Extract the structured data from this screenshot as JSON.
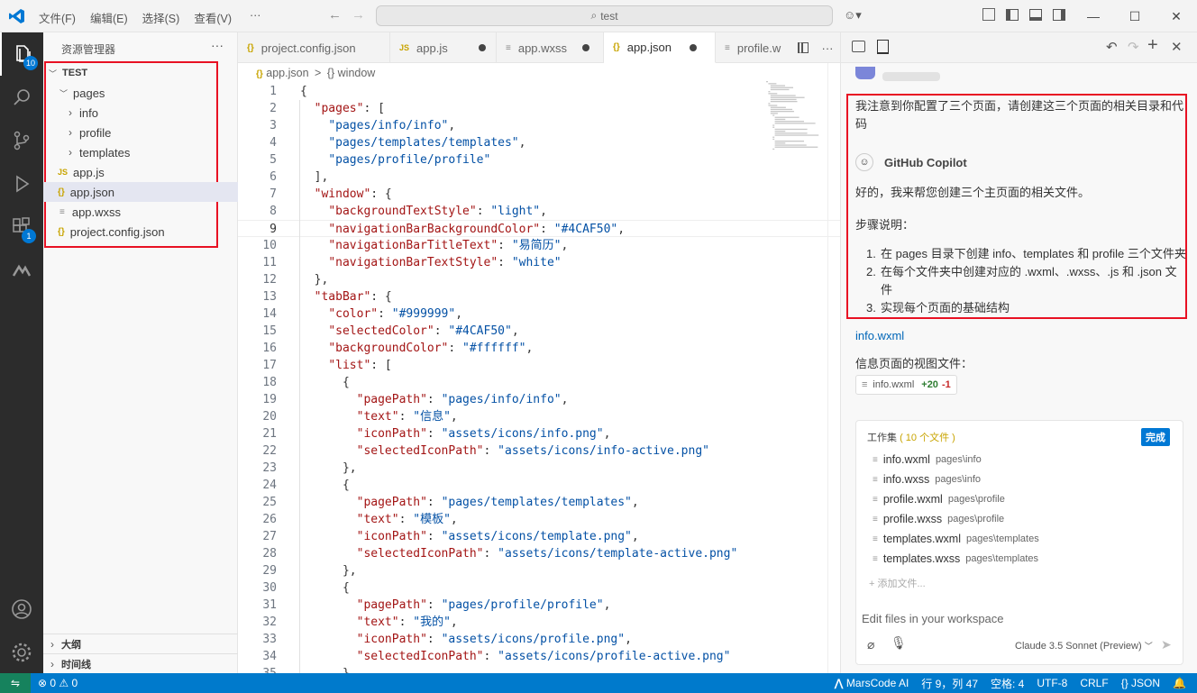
{
  "titlebar": {
    "menus": [
      "文件(F)",
      "编辑(E)",
      "选择(S)",
      "查看(V)",
      "···"
    ],
    "search": "test"
  },
  "activity": {
    "explorer_badge": "10",
    "extensions_badge": "1"
  },
  "sidebar": {
    "title": "资源管理器",
    "more": "···",
    "root": "TEST",
    "items": [
      {
        "label": "pages",
        "icon": "chevron-down-icon"
      },
      {
        "label": "info",
        "icon": "chevron-right-icon"
      },
      {
        "label": "profile",
        "icon": "chevron-right-icon"
      },
      {
        "label": "templates",
        "icon": "chevron-right-icon"
      },
      {
        "label": "app.js",
        "icon": "js-file-icon"
      },
      {
        "label": "app.json",
        "icon": "json-file-icon"
      },
      {
        "label": "app.wxss",
        "icon": "wxss-file-icon"
      },
      {
        "label": "project.config.json",
        "icon": "json-file-icon"
      }
    ],
    "outline": "大纲",
    "timeline": "时间线"
  },
  "tabs": [
    "project.config.json",
    "app.js",
    "app.wxss",
    "app.json",
    "profile.w"
  ],
  "breadcrumb": {
    "file": "app.json",
    "sep": ">",
    "node": "{} window"
  },
  "code": [
    "{",
    "  \"pages\": [",
    "    \"pages/info/info\",",
    "    \"pages/templates/templates\",",
    "    \"pages/profile/profile\"",
    "  ],",
    "  \"window\": {",
    "    \"backgroundTextStyle\": \"light\",",
    "    \"navigationBarBackgroundColor\": \"#4CAF50\",",
    "    \"navigationBarTitleText\": \"易简历\",",
    "    \"navigationBarTextStyle\": \"white\"",
    "  },",
    "  \"tabBar\": {",
    "    \"color\": \"#999999\",",
    "    \"selectedColor\": \"#4CAF50\",",
    "    \"backgroundColor\": \"#ffffff\",",
    "    \"list\": [",
    "      {",
    "        \"pagePath\": \"pages/info/info\",",
    "        \"text\": \"信息\",",
    "        \"iconPath\": \"assets/icons/info.png\",",
    "        \"selectedIconPath\": \"assets/icons/info-active.png\"",
    "      },",
    "      {",
    "        \"pagePath\": \"pages/templates/templates\",",
    "        \"text\": \"模板\",",
    "        \"iconPath\": \"assets/icons/template.png\",",
    "        \"selectedIconPath\": \"assets/icons/template-active.png\"",
    "      },",
    "      {",
    "        \"pagePath\": \"pages/profile/profile\",",
    "        \"text\": \"我的\",",
    "        \"iconPath\": \"assets/icons/profile.png\",",
    "        \"selectedIconPath\": \"assets/icons/profile-active.png\"",
    "      },"
  ],
  "chat": {
    "user_msg": "我注意到你配置了三个页面，请创建这三个页面的相关目录和代码",
    "copilot_name": "GitHub Copilot",
    "reply": "好的，我来帮您创建三个主页面的相关文件。",
    "steps_title": "步骤说明：",
    "steps": [
      "在 pages 目录下创建 info、templates 和 profile 三个文件夹",
      "在每个文件夹中创建对应的 .wxml、.wxss、.js 和 .json 文件",
      "实现每个页面的基础结构"
    ],
    "file_link": "info.wxml",
    "file_desc": "信息页面的视图文件：",
    "chip": {
      "name": "info.wxml",
      "add": "+20",
      "del": "-1"
    },
    "workset": {
      "title": "工作集",
      "count": "( 10 个文件 )",
      "done": "完成",
      "files": [
        {
          "name": "info.wxml",
          "path": "pages\\info"
        },
        {
          "name": "info.wxss",
          "path": "pages\\info"
        },
        {
          "name": "profile.wxml",
          "path": "pages\\profile"
        },
        {
          "name": "profile.wxss",
          "path": "pages\\profile"
        },
        {
          "name": "templates.wxml",
          "path": "pages\\templates"
        },
        {
          "name": "templates.wxss",
          "path": "pages\\templates"
        }
      ],
      "add": "+ 添加文件..."
    },
    "input_placeholder": "Edit files in your workspace",
    "model": "Claude 3.5 Sonnet (Preview)"
  },
  "status": {
    "problems": "⊗ 0 ⚠ 0",
    "marscode": "MarsCode AI",
    "position": "行 9，列 47",
    "spaces": "空格: 4",
    "encoding": "UTF-8",
    "eol": "CRLF",
    "lang": "{} JSON"
  }
}
